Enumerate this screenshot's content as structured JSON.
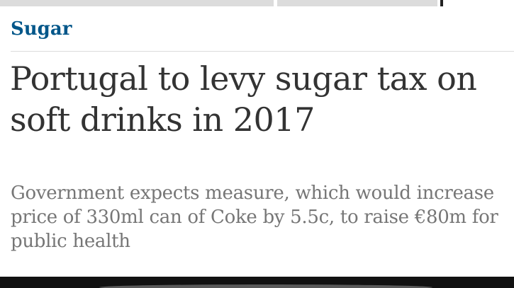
{
  "article": {
    "section": "Sugar",
    "headline": "Portugal to levy sugar tax on soft drinks in 2017",
    "standfirst": "Government expects measure, which would increase price of 330ml can of Coke by 5.5c, to raise €80m for public health"
  },
  "colors": {
    "section": "#005689",
    "headline": "#333333",
    "standfirst": "#767676"
  }
}
